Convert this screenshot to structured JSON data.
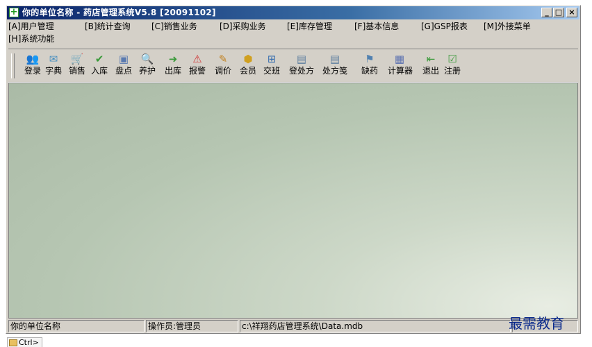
{
  "window": {
    "title": "你的单位名称 - 药店管理系统V5.8 [20091102]",
    "controls": {
      "minimize": "_",
      "maximize": "□",
      "close": "×"
    }
  },
  "menu": [
    "[A]用户管理",
    "[B]统计查询",
    "[C]销售业务",
    "[D]采购业务",
    "[E]库存管理",
    "[F]基本信息",
    "[G]GSP报表",
    "[M]外接菜单",
    "[H]系统功能"
  ],
  "toolbar": [
    {
      "label": "登录",
      "icon": "login-icon",
      "glyph": "👥",
      "color": "#e0a020"
    },
    {
      "label": "字典",
      "icon": "dictionary-icon",
      "glyph": "✉",
      "color": "#4a90c0"
    },
    {
      "label": "销售",
      "icon": "cart-icon",
      "glyph": "🛒",
      "color": "#3a70b0"
    },
    {
      "label": "入库",
      "icon": "stock-in-icon",
      "glyph": "✔",
      "color": "#3a9a3a"
    },
    {
      "label": "盘点",
      "icon": "inventory-icon",
      "glyph": "▣",
      "color": "#5a7ab0"
    },
    {
      "label": "养护",
      "icon": "search-icon",
      "glyph": "🔍",
      "color": "#3a70b0"
    },
    {
      "label": "出库",
      "icon": "stock-out-icon",
      "glyph": "➜",
      "color": "#3a9a3a"
    },
    {
      "label": "报警",
      "icon": "alarm-icon",
      "glyph": "⚠",
      "color": "#d03030"
    },
    {
      "label": "调价",
      "icon": "price-adjust-icon",
      "glyph": "✎",
      "color": "#c08020"
    },
    {
      "label": "会员",
      "icon": "member-icon",
      "glyph": "⬢",
      "color": "#d0a020"
    },
    {
      "label": "交班",
      "icon": "shift-handover-icon",
      "glyph": "⊞",
      "color": "#3a70b0"
    },
    {
      "label": "登处方",
      "icon": "prescription-entry-icon",
      "glyph": "▤",
      "color": "#6080a0"
    },
    {
      "label": "处方笺",
      "icon": "prescription-note-icon",
      "glyph": "▤",
      "color": "#6080a0"
    },
    {
      "label": "缺药",
      "icon": "shortage-icon",
      "glyph": "⚑",
      "color": "#5080b0"
    },
    {
      "label": "计算器",
      "icon": "calculator-icon",
      "glyph": "▦",
      "color": "#5a70b0"
    },
    {
      "label": "退出",
      "icon": "exit-icon",
      "glyph": "⇤",
      "color": "#3a9a3a"
    },
    {
      "label": "注册",
      "icon": "register-icon",
      "glyph": "☑",
      "color": "#3a9a3a"
    }
  ],
  "statusbar": {
    "company": "你的单位名称",
    "operator": "操作员:管理员",
    "db_path": "c:\\祥翔药店管理系统\\Data.mdb"
  },
  "watermark": "最需教育",
  "taskbar": {
    "item": "Ctrl>"
  }
}
